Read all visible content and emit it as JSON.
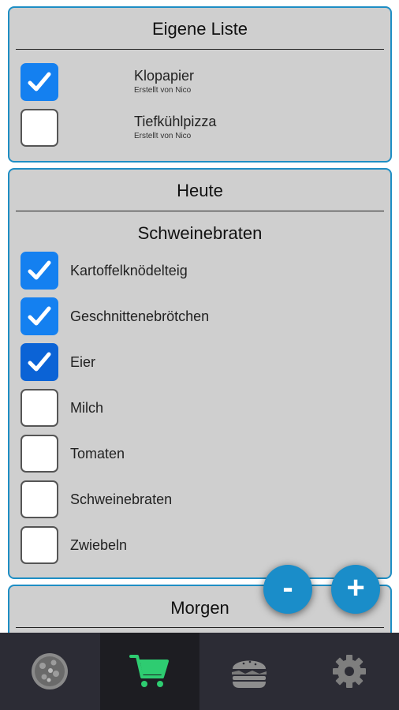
{
  "own_list": {
    "title": "Eigene Liste",
    "items": [
      {
        "label": "Klopapier",
        "subtitle": "Erstellt von Nico",
        "checked": true
      },
      {
        "label": "Tiefkühlpizza",
        "subtitle": "Erstellt von Nico",
        "checked": false
      }
    ]
  },
  "today": {
    "title": "Heute",
    "recipe": "Schweinebraten",
    "items": [
      {
        "label": "Kartoffelknödelteig",
        "checked": true
      },
      {
        "label": "Geschnittenebrötchen",
        "checked": true
      },
      {
        "label": "Eier",
        "checked": true
      },
      {
        "label": "Milch",
        "checked": false
      },
      {
        "label": "Tomaten",
        "checked": false
      },
      {
        "label": "Schweinebraten",
        "checked": false
      },
      {
        "label": "Zwiebeln",
        "checked": false
      }
    ]
  },
  "tomorrow": {
    "title": "Morgen"
  },
  "fab": {
    "minus": "-",
    "plus": "+"
  },
  "nav": [
    {
      "icon": "pizza-icon",
      "active": false
    },
    {
      "icon": "cart-icon",
      "active": true
    },
    {
      "icon": "burger-icon",
      "active": false
    },
    {
      "icon": "gear-icon",
      "active": false
    }
  ],
  "colors": {
    "accent": "#1e8ec4",
    "checkbox": "#1480f0",
    "cart": "#2ecc71",
    "nav_bg": "#2c2c35"
  }
}
